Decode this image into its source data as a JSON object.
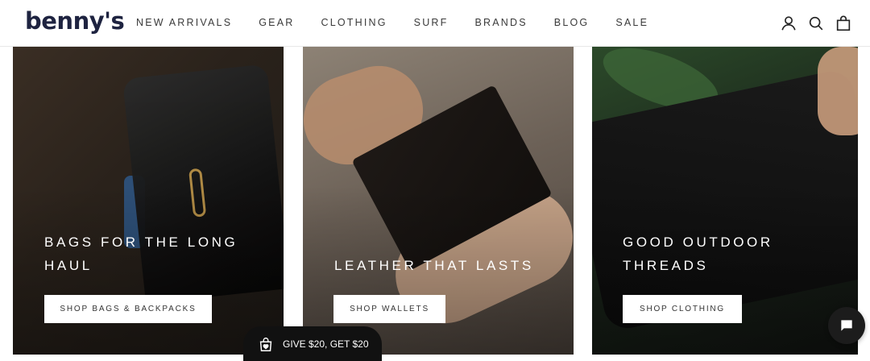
{
  "brand": {
    "logo": "benny's"
  },
  "nav": {
    "items": [
      "NEW ARRIVALS",
      "GEAR",
      "CLOTHING",
      "SURF",
      "BRANDS",
      "BLOG",
      "SALE"
    ]
  },
  "header_icons": [
    "account-icon",
    "search-icon",
    "cart-icon"
  ],
  "cards": [
    {
      "title": "BAGS FOR THE LONG HAUL",
      "button": "SHOP BAGS & BACKPACKS"
    },
    {
      "title": "LEATHER THAT LASTS",
      "button": "SHOP WALLETS"
    },
    {
      "title": "GOOD OUTDOOR THREADS",
      "button": "SHOP CLOTHING"
    }
  ],
  "promo": {
    "label": "GIVE $20, GET $20",
    "icon": "gift-bag-icon"
  },
  "chat": {
    "icon": "chat-icon"
  }
}
